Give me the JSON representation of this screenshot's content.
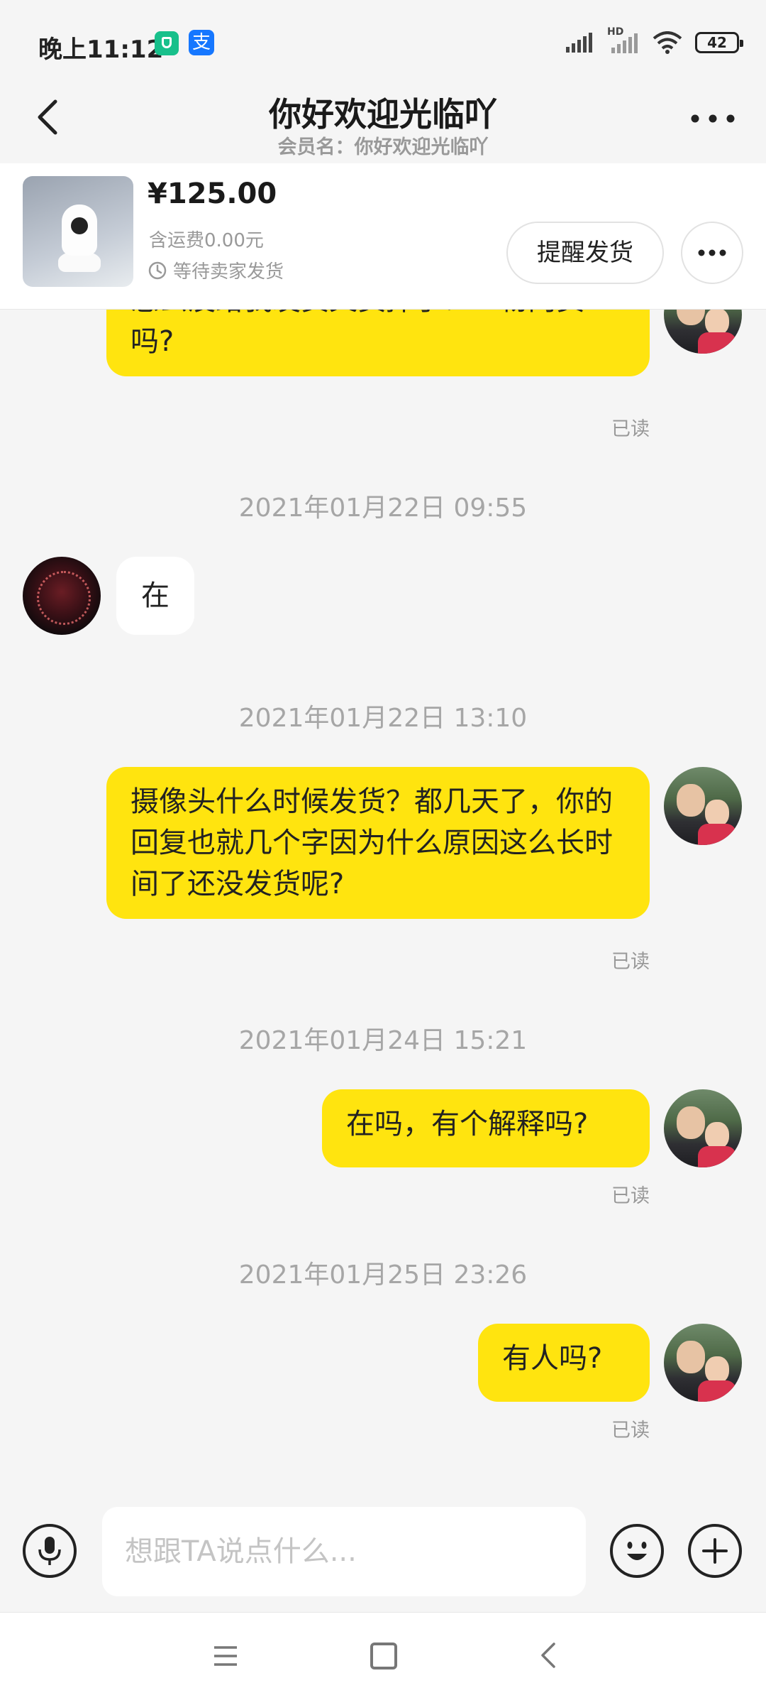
{
  "status_bar": {
    "time": "晚上11:12",
    "alipay_glyph": "支",
    "battery": "42",
    "network_label": "HD"
  },
  "header": {
    "title": "你好欢迎光临吖",
    "subtitle": "会员名：你好欢迎光临吖"
  },
  "product": {
    "price": "¥125.00",
    "shipping": "含运费0.00元",
    "status": "等待卖家发货",
    "remind_button": "提醒发货"
  },
  "messages": {
    "m1": {
      "sender": "me",
      "text": "怎么没给我发货又卖掉了？一物两卖吗?",
      "read": "已读"
    },
    "t1": "2021年01月22日 09:55",
    "m2": {
      "sender": "other",
      "text": "在"
    },
    "t2": "2021年01月22日 13:10",
    "m3": {
      "sender": "me",
      "text": "摄像头什么时候发货？都几天了，你的回复也就几个字因为什么原因这么长时间了还没发货呢?",
      "read": "已读"
    },
    "t3": "2021年01月24日 15:21",
    "m4": {
      "sender": "me",
      "text": "在吗，有个解释吗?",
      "read": "已读"
    },
    "t4": "2021年01月25日 23:26",
    "m5": {
      "sender": "me",
      "text": "有人吗?",
      "read": "已读"
    }
  },
  "input": {
    "placeholder": "想跟TA说点什么..."
  },
  "icons": {
    "back": "back-arrow-icon",
    "more": "more-dots-icon",
    "voice": "microphone-icon",
    "emoji": "emoji-icon",
    "plus": "plus-icon",
    "clock": "clock-icon"
  },
  "colors": {
    "my_bubble": "#ffe40f",
    "other_bubble": "#ffffff",
    "background": "#f5f5f5"
  }
}
